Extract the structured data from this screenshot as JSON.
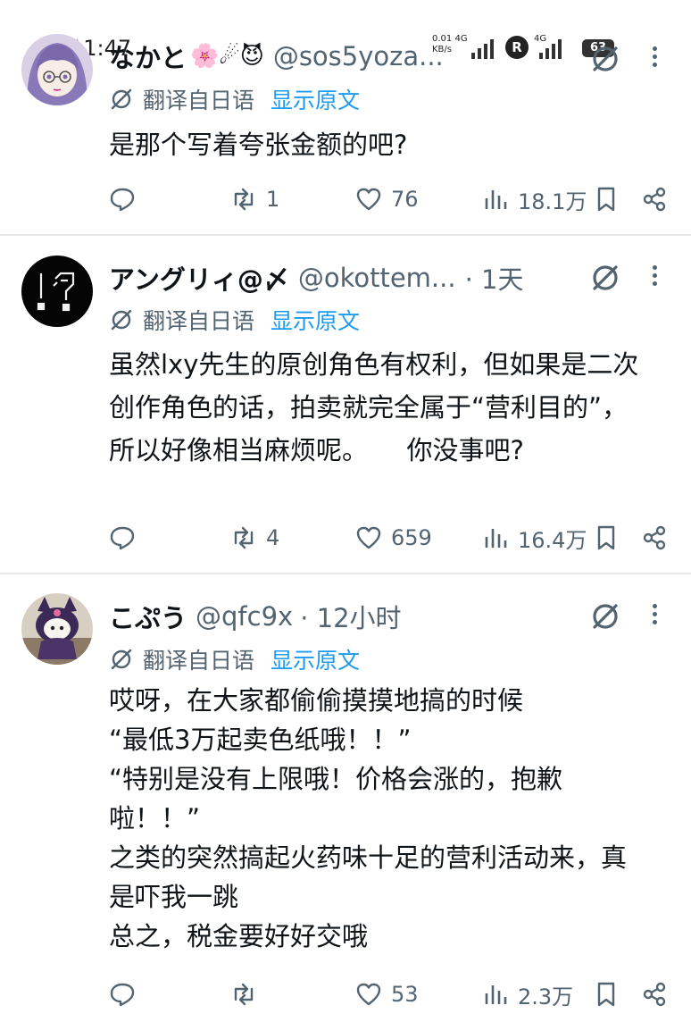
{
  "status_bar": {
    "time": "11:47",
    "net_rate": "0.01",
    "net_type": "4G",
    "net_unit": "KB/s",
    "net_type_2": "4G",
    "r_badge": "R",
    "battery": "63"
  },
  "tweets": [
    {
      "name": "なかと",
      "emojis": "🌸☄😈",
      "handle": "@sos5yoza...",
      "time": "",
      "translate_label": "翻译自日语",
      "show_original": "显示原文",
      "lines": [
        "是那个写着夸张金额的吧?"
      ],
      "replies": "",
      "retweets": "1",
      "likes": "76",
      "views": "18.1万"
    },
    {
      "name": "アングリィ@〆",
      "emojis": "",
      "handle": "@okottem...",
      "time": "· 1天",
      "translate_label": "翻译自日语",
      "show_original": "显示原文",
      "lines": [
        "虽然lxy先生的原创角色有权利，但如果是二次创作角色的话，拍卖就完全属于“营利目的”，所以好像相当麻烦呢。　　你没事吧?"
      ],
      "replies": "",
      "retweets": "4",
      "likes": "659",
      "views": "16.4万"
    },
    {
      "name": "こぷう",
      "emojis": "",
      "handle": "@qfc9x",
      "time": "· 12小时",
      "translate_label": "翻译自日语",
      "show_original": "显示原文",
      "lines": [
        "哎呀，在大家都偷偷摸摸地搞的时候",
        "“最低3万起卖色纸哦！！”",
        "“特别是没有上限哦！价格会涨的，抱歉啦！！”",
        "之类的突然搞起火药味十足的营利活动来，真是吓我一跳",
        "总之，税金要好好交哦"
      ],
      "replies": "",
      "retweets": "",
      "likes": "53",
      "views": "2.3万"
    }
  ],
  "colors": {
    "text": "#0f1419",
    "secondary": "#536471",
    "link": "#1d9bf0",
    "divider": "#e6e8ea"
  }
}
